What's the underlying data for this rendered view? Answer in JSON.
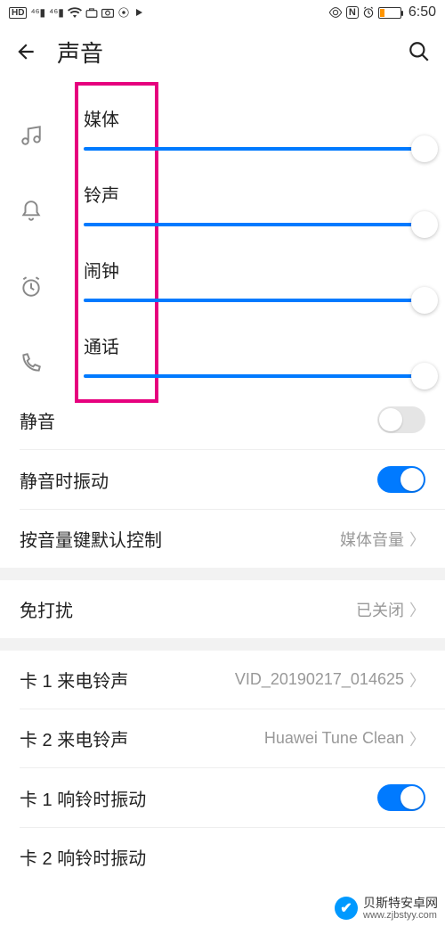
{
  "status": {
    "time": "6:50"
  },
  "header": {
    "title": "声音"
  },
  "sliders": [
    {
      "label": "媒体",
      "value": 100
    },
    {
      "label": "铃声",
      "value": 100
    },
    {
      "label": "闹钟",
      "value": 100
    },
    {
      "label": "通话",
      "value": 100
    }
  ],
  "rows": {
    "mute": {
      "label": "静音",
      "on": false
    },
    "vibrate_on_mute": {
      "label": "静音时振动",
      "on": true
    },
    "default_volume_key": {
      "label": "按音量键默认控制",
      "value": "媒体音量"
    },
    "dnd": {
      "label": "免打扰",
      "value": "已关闭"
    },
    "sim1_ringtone": {
      "label": "卡 1 来电铃声",
      "value": "VID_20190217_014625"
    },
    "sim2_ringtone": {
      "label": "卡 2 来电铃声",
      "value": "Huawei Tune Clean"
    },
    "sim1_vibrate": {
      "label": "卡 1 响铃时振动",
      "on": true
    },
    "sim2_vibrate": {
      "label": "卡 2 响铃时振动"
    }
  },
  "watermark": {
    "name": "贝斯特安卓网",
    "url": "www.zjbstyy.com"
  }
}
